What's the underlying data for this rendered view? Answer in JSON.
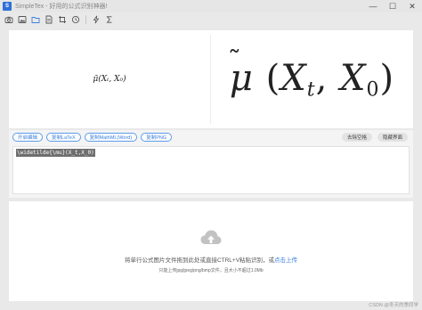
{
  "window": {
    "logo_text": "S",
    "title": "SimpleTex - 好用的公式识别神器!",
    "minimize": "—",
    "maximize": "☐",
    "close": "✕"
  },
  "toolbar": {
    "icons": [
      "camera-icon",
      "image-icon",
      "folder-icon",
      "document-icon",
      "crop-icon",
      "history-icon",
      "lightning-icon",
      "sigma-icon"
    ]
  },
  "preview": {
    "small_formula": "μ̃(Xₜ, X₀)",
    "large_formula_base": "μ",
    "large_formula_paren_open": "(",
    "large_formula_x1": "X",
    "large_formula_sub1": "t",
    "large_formula_comma": ",",
    "large_formula_x2": "X",
    "large_formula_sub2": "0",
    "large_formula_paren_close": ")"
  },
  "actions": {
    "buttons": [
      "开启编辑",
      "复制LaTeX",
      "复制MathML(Word)",
      "复制PNG"
    ],
    "right_buttons": [
      "去除空格",
      "隐藏界面"
    ],
    "latex_value": "\\widetilde{\\mu}(X_t,X_0)"
  },
  "upload": {
    "main_text": "将单行公式图片文件拖到此处或直接CTRL+V粘贴识别，或",
    "link_text": "点击上传",
    "note": "只能上传jpg/jpeg/png/bmp文件，且大小不超过1.0Mb"
  },
  "watermark": "CSDN @冬天的季同学",
  "colors": {
    "accent": "#3a80dc",
    "brand": "#2f6fd6"
  }
}
